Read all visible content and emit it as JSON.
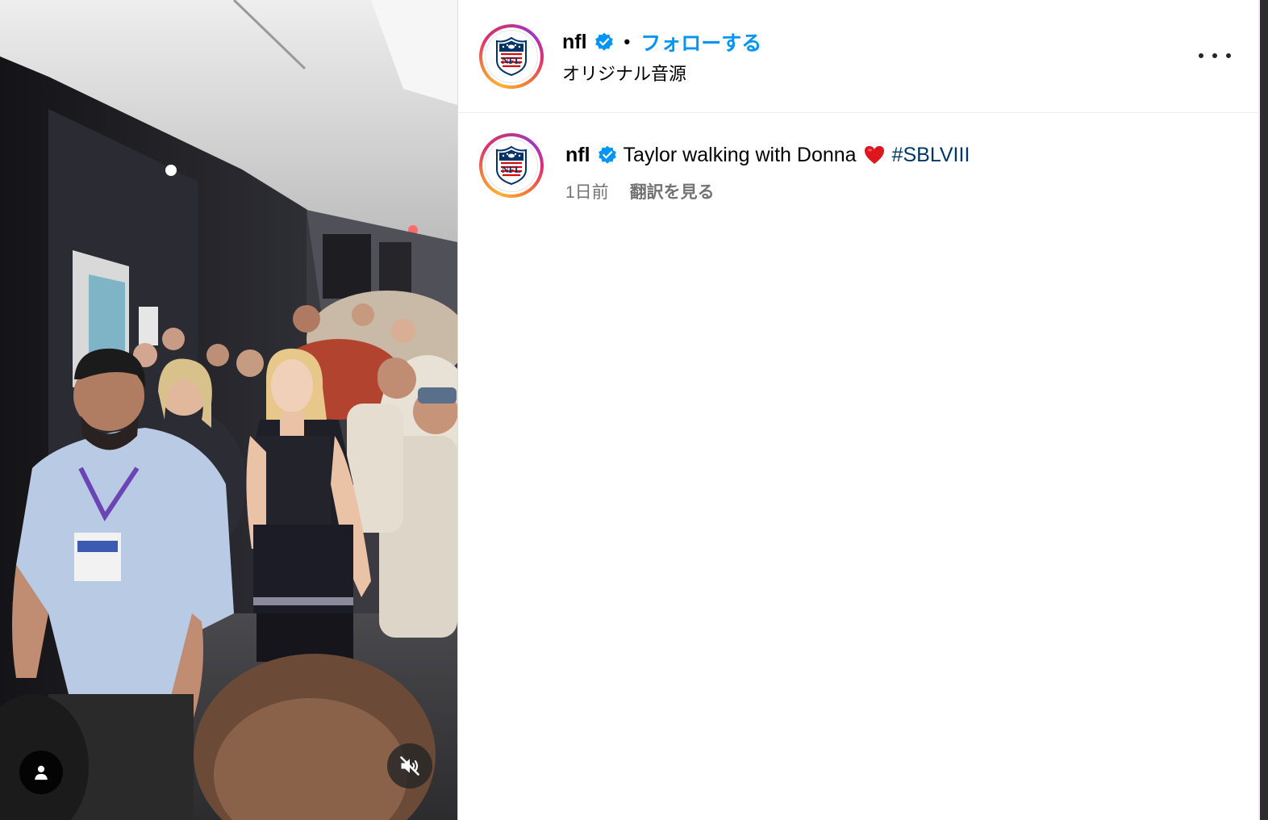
{
  "post": {
    "username": "nfl",
    "separator": "•",
    "follow_label": "フォローする",
    "audio_label": "オリジナル音源",
    "more_icon": "more-horizontal-icon"
  },
  "caption": {
    "username": "nfl",
    "text": "Taylor walking with Donna",
    "emoji": "❤️",
    "hashtag": "#SBLVIII",
    "timestamp": "1日前",
    "translate_label": "翻訳を見る"
  },
  "media": {
    "type": "video",
    "muted": true,
    "tag_icon": "user-tag-icon",
    "mute_icon": "speaker-muted-icon"
  },
  "avatar": {
    "logo_text": "NFL",
    "logo_icon": "nfl-shield-logo"
  },
  "colors": {
    "follow_blue": "#0095f6",
    "hashtag_blue": "#00376b",
    "verified_blue": "#0095f6",
    "secondary_text": "#737373",
    "nfl_navy": "#013369",
    "nfl_red": "#d50a0a"
  }
}
